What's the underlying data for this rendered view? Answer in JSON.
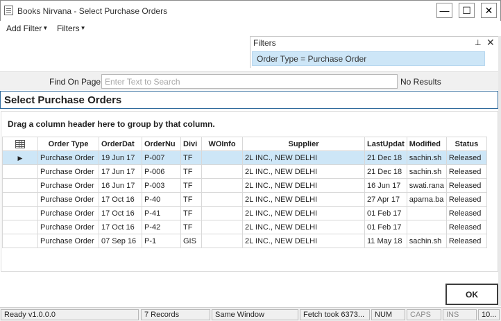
{
  "window": {
    "title": "Books Nirvana - Select Purchase Orders",
    "minimize": "—",
    "maximize": "☐",
    "close": "✕"
  },
  "menu": {
    "add_filter": "Add Filter",
    "filters": "Filters"
  },
  "filters_panel": {
    "title": "Filters",
    "active_filter": "Order Type = Purchase Order"
  },
  "find": {
    "label": "Find On Page",
    "placeholder": "Enter Text to Search",
    "result": "No Results"
  },
  "section": {
    "title": "Select Purchase Orders"
  },
  "grid": {
    "group_hint": "Drag a column header here to group by that column.",
    "columns": [
      "Order Type",
      "OrderDat",
      "OrderNu",
      "Divi",
      "WOInfo",
      "Supplier",
      "LastUpdat",
      "Modified",
      "Status"
    ],
    "rows": [
      [
        "Purchase Order",
        "19 Jun 17",
        "P-007",
        "TF",
        "",
        "2L INC., NEW DELHI",
        "21 Dec 18",
        "sachin.sh",
        "Released"
      ],
      [
        "Purchase Order",
        "17 Jun 17",
        "P-006",
        "TF",
        "",
        "2L INC., NEW DELHI",
        "21 Dec 18",
        "sachin.sh",
        "Released"
      ],
      [
        "Purchase Order",
        "16 Jun 17",
        "P-003",
        "TF",
        "",
        "2L INC., NEW DELHI",
        "16 Jun 17",
        "swati.rana",
        "Released"
      ],
      [
        "Purchase Order",
        "17 Oct 16",
        "P-40",
        "TF",
        "",
        "2L INC., NEW DELHI",
        "27 Apr 17",
        "aparna.ba",
        "Released"
      ],
      [
        "Purchase Order",
        "17 Oct 16",
        "P-41",
        "TF",
        "",
        "2L INC., NEW DELHI",
        "01 Feb 17",
        "",
        "Released"
      ],
      [
        "Purchase Order",
        "17 Oct 16",
        "P-42",
        "TF",
        "",
        "2L INC., NEW DELHI",
        "01 Feb 17",
        "",
        "Released"
      ],
      [
        "Purchase Order",
        "07 Sep 16",
        "P-1",
        "GIS",
        "",
        "2L INC., NEW DELHI",
        "11 May 18",
        "sachin.sh",
        "Released"
      ]
    ],
    "selected_row": 0
  },
  "buttons": {
    "ok": "OK"
  },
  "status": {
    "version": "Ready v1.0.0.0",
    "records": "7 Records",
    "window_mode": "Same Window",
    "fetch": "Fetch took 6373...",
    "num": "NUM",
    "caps": "CAPS",
    "ins": "INS",
    "extra": "10..."
  }
}
